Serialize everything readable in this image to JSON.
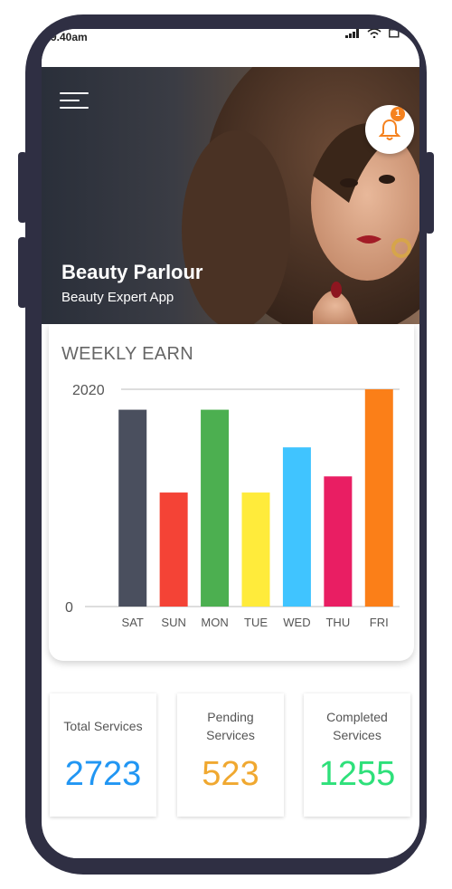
{
  "status_bar": {
    "time": "9.40am",
    "icons": [
      "signal-icon",
      "wifi-icon",
      "battery-icon"
    ]
  },
  "hero": {
    "title": "Beauty Parlour",
    "subtitle": "Beauty Expert App",
    "notification_count": "1",
    "icons": [
      "menu-icon",
      "bell-icon"
    ]
  },
  "chart_section": {
    "title": "WEEKLY EARN"
  },
  "chart_data": {
    "type": "bar",
    "categories": [
      "SAT",
      "SUN",
      "MON",
      "TUE",
      "WED",
      "THU",
      "FRI"
    ],
    "values": [
      1830,
      1060,
      1830,
      1060,
      1480,
      1210,
      2020
    ],
    "colors": [
      "#4a4f5e",
      "#f44336",
      "#4caf50",
      "#ffeb3b",
      "#40c4ff",
      "#e91e63",
      "#fb7f18"
    ],
    "title": "WEEKLY EARN",
    "xlabel": "",
    "ylabel": "",
    "yticks": [
      "0",
      "2020"
    ],
    "ylim": [
      0,
      2020
    ],
    "grid": false
  },
  "stats": {
    "total_label": "Total Services",
    "total_value": "2723",
    "total_color": "#2196f3",
    "pending_label": "Pending\nServices",
    "pending_value": "523",
    "pending_color": "#f0a830",
    "completed_label": "Completed\nServices",
    "completed_value": "1255",
    "completed_color": "#2ee07a"
  },
  "colors": {
    "frame": "#2f2f43",
    "accent": "#f5821f"
  }
}
